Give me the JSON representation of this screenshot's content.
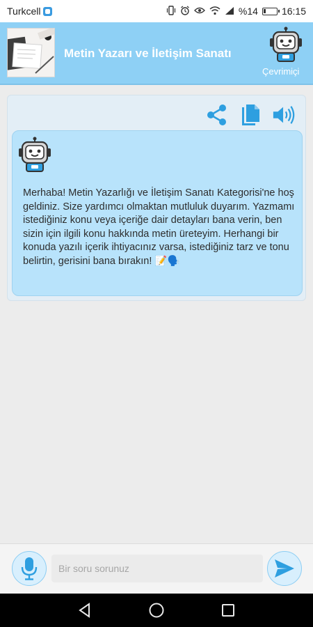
{
  "status_bar": {
    "carrier": "Turkcell",
    "battery_text": "%14",
    "time": "16:15",
    "icons": [
      "vibrate-icon",
      "alarm-icon",
      "eye-comfort-icon",
      "wifi-icon",
      "signal-icon",
      "battery-icon"
    ]
  },
  "header": {
    "title": "Metin Yazarı ve İletişim Sanatı",
    "status": "Çevrimiçi"
  },
  "chat": {
    "actions": [
      "share-icon",
      "copy-icon",
      "speaker-icon"
    ],
    "message": "Merhaba! Metin Yazarlığı ve İletişim Sanatı Kategorisi'ne hoş geldiniz. Size yardımcı olmaktan mutluluk duyarım. Yazmamı istediğiniz konu veya içeriğe dair detayları bana verin, ben sizin için ilgili konu hakkında metin üreteyim. Herhangi bir konuda yazılı içerik ihtiyacınız varsa, istediğiniz tarz ve tonu belirtin, gerisini bana bırakın! 📝🗣️"
  },
  "input": {
    "placeholder": "Bir soru sorunuz",
    "value": ""
  },
  "nav": [
    "back-icon",
    "home-icon",
    "recents-icon"
  ],
  "colors": {
    "header_bg": "#8ed0f5",
    "bubble_bg": "#b8e3fb",
    "accent": "#2e9fe0"
  }
}
